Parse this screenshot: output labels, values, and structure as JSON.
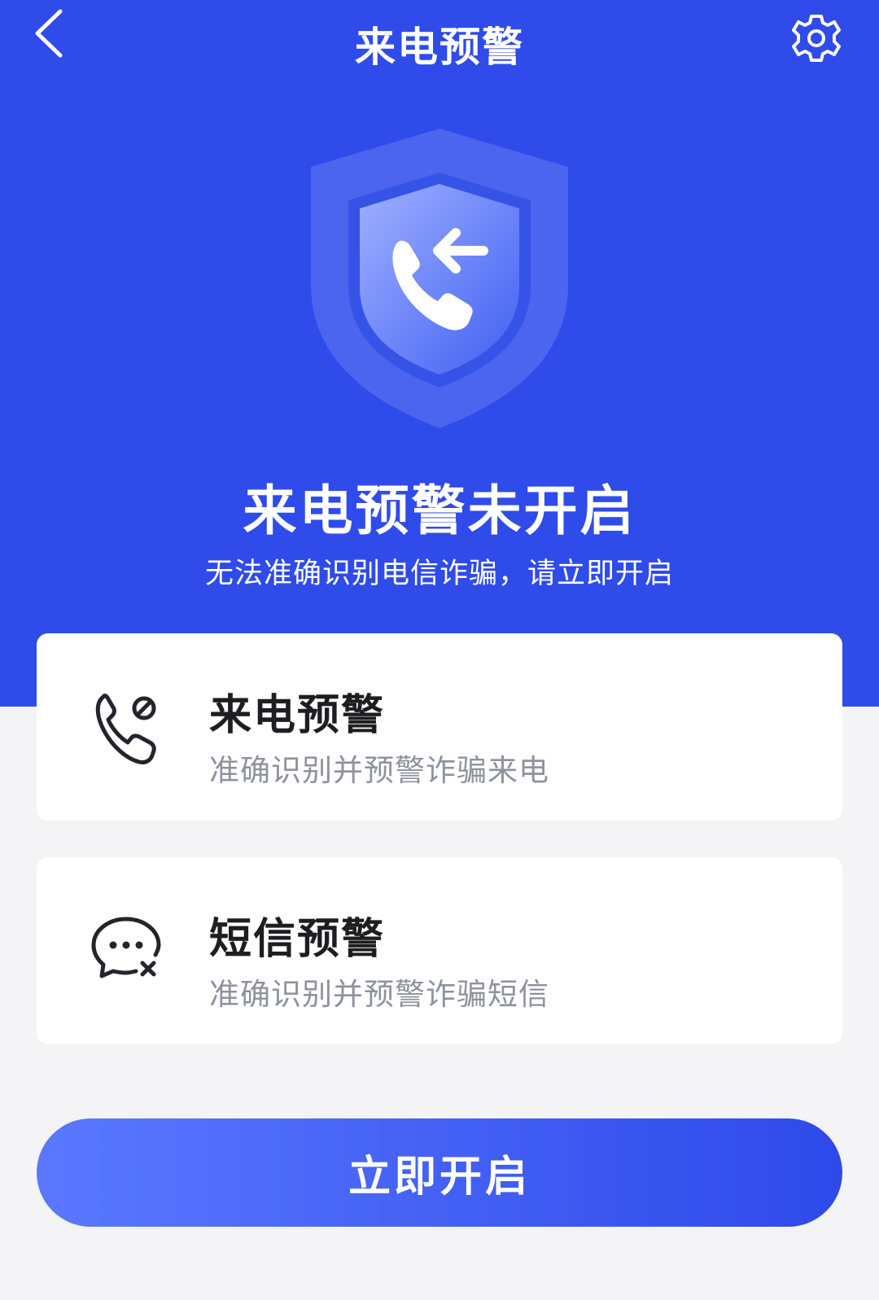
{
  "header": {
    "title": "来电预警",
    "back_icon": "chevron-left-icon",
    "settings_icon": "gear-icon"
  },
  "hero": {
    "icon": "shield-incoming-call-icon",
    "status_title": "来电预警未开启",
    "status_subtitle": "无法准确识别电信诈骗，请立即开启"
  },
  "features": [
    {
      "icon": "call-block-icon",
      "title": "来电预警",
      "description": "准确识别并预警诈骗来电"
    },
    {
      "icon": "message-block-icon",
      "title": "短信预警",
      "description": "准确识别并预警诈骗短信"
    }
  ],
  "action": {
    "label": "立即开启"
  },
  "colors": {
    "primary": "#2f4bea",
    "background": "#f4f4f6",
    "title_text": "#1e1e22",
    "secondary_text": "#8d929c"
  }
}
